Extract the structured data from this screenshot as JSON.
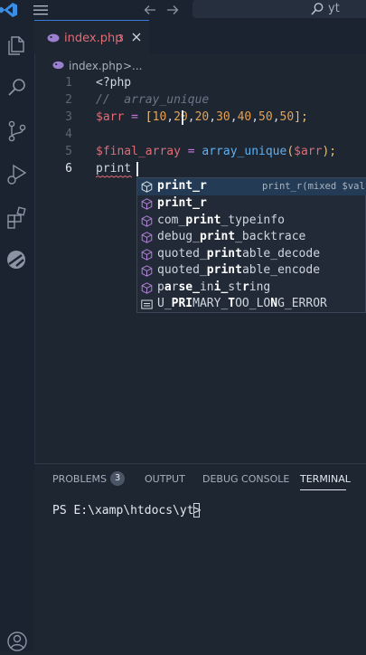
{
  "titlebar": {
    "search_text": "yt"
  },
  "tab": {
    "file_name": "index.php",
    "problem_count": "3"
  },
  "breadcrumb": {
    "file": "index.php",
    "separator": ">",
    "more": "..."
  },
  "editor": {
    "lines": [
      {
        "number": "1",
        "text": "<?php"
      },
      {
        "number": "2",
        "text": "//  array_unique"
      },
      {
        "number": "3",
        "text": "$arr = [10,20,20,30,40,50,50];"
      },
      {
        "number": "4",
        "text": ""
      },
      {
        "number": "5",
        "text": "$final_array = array_unique($arr);"
      },
      {
        "number": "6",
        "text": "print "
      }
    ],
    "tokens": {
      "php_open": "<?php",
      "comment": "//  array_unique",
      "arr_var": "$arr",
      "assign": " = ",
      "lbracket": "[",
      "n10": "10",
      "n20a": "20",
      "n20b": "20",
      "n30": "30",
      "n40": "40",
      "n50a": "50",
      "n50b": "50",
      "comma": ",",
      "rbracket_semi": "];",
      "final_var": "$final_array",
      "func": "array_unique",
      "lparen": "(",
      "arr_arg": "$arr",
      "rparen_semi": ");",
      "print_word": "print"
    }
  },
  "suggestions": [
    {
      "parts": [
        [
          "",
          "print_r",
          ""
        ]
      ],
      "icon": "method",
      "selected": true,
      "detail": "print_r(mixed $val"
    },
    {
      "parts": [
        [
          "",
          "print_r",
          ""
        ]
      ],
      "icon": "method",
      "selected": false,
      "detail": ""
    },
    {
      "parts": [
        [
          "com_",
          "print",
          "_typeinfo"
        ]
      ],
      "icon": "method",
      "selected": false,
      "detail": ""
    },
    {
      "parts": [
        [
          "debug_",
          "print",
          "_backtrace"
        ]
      ],
      "icon": "method",
      "selected": false,
      "detail": ""
    },
    {
      "parts": [
        [
          "quoted_",
          "print",
          "able_decode"
        ]
      ],
      "icon": "method",
      "selected": false,
      "detail": ""
    },
    {
      "parts": [
        [
          "quoted_",
          "print",
          "able_encode"
        ]
      ],
      "icon": "method",
      "selected": false,
      "detail": ""
    },
    {
      "parts": [
        [
          "p",
          "a",
          "r"
        ],
        [
          "",
          "se_",
          "in"
        ],
        [
          "",
          "i_",
          "st"
        ],
        [
          "",
          "r",
          "ing"
        ]
      ],
      "icon": "method",
      "selected": false,
      "detail": ""
    },
    {
      "parts": [
        [
          "U_",
          "PRI",
          "MARY_"
        ],
        [
          "",
          "T",
          "OO_LO"
        ],
        [
          "",
          "N",
          "G_ERROR"
        ]
      ],
      "icon": "constant",
      "selected": false,
      "detail": ""
    }
  ],
  "panel": {
    "tabs": [
      "PROBLEMS",
      "OUTPUT",
      "DEBUG CONSOLE",
      "TERMINAL"
    ],
    "problems_badge": "3",
    "active_tab": "TERMINAL",
    "prompt": "PS E:\\xamp\\htdocs\\yt> "
  },
  "colors": {
    "accent": "#3a7bd5",
    "error": "#e06c75",
    "background": "#1e2632"
  }
}
